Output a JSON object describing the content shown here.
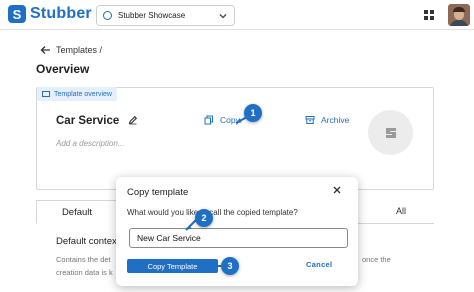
{
  "header": {
    "brand": "Stubber",
    "brand_mark": "S",
    "org_name": "Stubber Showcase",
    "apps_icon": "grid-icon",
    "avatar": "user-avatar"
  },
  "breadcrumb": {
    "parent": "Templates /"
  },
  "page": {
    "title": "Overview"
  },
  "card": {
    "chip_label": "Template overview",
    "template_name": "Car Service",
    "description_placeholder": "Add a description...",
    "copy_label": "Copy",
    "archive_label": "Archive"
  },
  "tabs": {
    "default_label": "Default",
    "all_label": "All"
  },
  "section": {
    "title": "Default contex",
    "text_line1": "Contains the det",
    "text_line2": "creation data is k",
    "text_right1": "once the"
  },
  "dialog": {
    "title": "Copy template",
    "question": "What would you like to call the copied template?",
    "input_value": "New Car Service",
    "copy_button": "Copy Template",
    "cancel_button": "Cancel"
  },
  "steps": [
    "1",
    "2",
    "3"
  ],
  "colors": {
    "accent": "#1f6fc5",
    "chip_bg": "#e6f0fb"
  }
}
